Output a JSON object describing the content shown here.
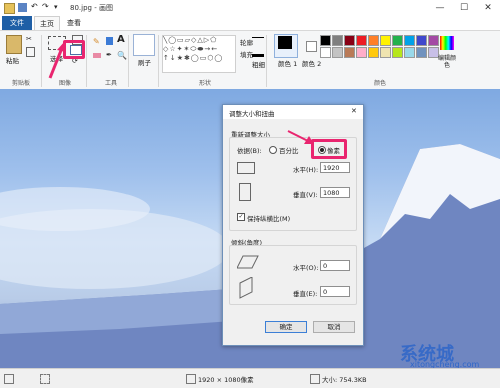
{
  "window": {
    "title": "80.jpg - 画图",
    "minimize": "—",
    "maximize": "☐",
    "close": "✕"
  },
  "tabs": {
    "file": "文件",
    "home": "主页",
    "view": "查看"
  },
  "ribbon": {
    "clipboard": {
      "paste": "粘贴",
      "label": "剪贴板"
    },
    "image": {
      "select": "选择",
      "label": "图像"
    },
    "tools": {
      "label": "工具"
    },
    "brushes": {
      "label": "刷子"
    },
    "shapes": {
      "label": "形状",
      "outline": "轮廓",
      "fill": "填充"
    },
    "size": {
      "label": "粗细"
    },
    "colors": {
      "color1": "颜色 1",
      "color2": "颜色 2",
      "edit": "编辑颜色",
      "label": "颜色"
    },
    "palette": [
      "#000000",
      "#7f7f7f",
      "#880015",
      "#ed1c24",
      "#ff7f27",
      "#fff200",
      "#22b14c",
      "#00a2e8",
      "#3f48cc",
      "#a349a4",
      "#ffffff",
      "#c3c3c3",
      "#b97a57",
      "#ffaec9",
      "#ffc90e",
      "#efe4b0",
      "#b5e61d",
      "#99d9ea",
      "#7092be",
      "#c8bfe7"
    ]
  },
  "dialog": {
    "title": "调整大小和扭曲",
    "resize_section": "重新调整大小",
    "by_label": "依据(B):",
    "percent": "百分比",
    "pixels": "像素",
    "horizontal_label": "水平(H):",
    "horizontal_value": "1920",
    "vertical_label": "垂直(V):",
    "vertical_value": "1080",
    "keep_ratio": "保持纵横比(M)",
    "skew_section": "倾斜(角度)",
    "skew_h_label": "水平(O):",
    "skew_h_value": "0",
    "skew_v_label": "垂直(E):",
    "skew_v_value": "0",
    "ok": "确定",
    "cancel": "取消"
  },
  "status": {
    "dimensions": "1920 × 1080像素",
    "size": "大小: 754.3KB"
  },
  "watermark": {
    "brand": "系统城",
    "url": "xitongcheng.com"
  },
  "colors": {
    "file_tab": "#1f5fa6",
    "highlight": "#e9256f"
  }
}
